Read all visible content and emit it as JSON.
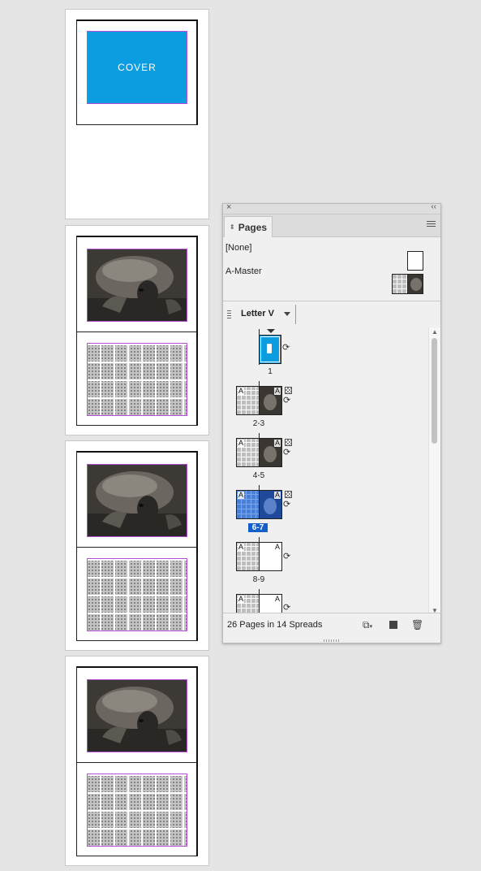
{
  "document": {
    "cover_label": "COVER"
  },
  "panel": {
    "tab_label": "Pages",
    "masters": [
      {
        "name": "[None]"
      },
      {
        "name": "A-Master"
      }
    ],
    "page_size": "Letter V",
    "spreads": [
      {
        "label": "1",
        "master_prefix": "",
        "selected": false
      },
      {
        "label": "2-3",
        "master_prefix": "A",
        "selected": false
      },
      {
        "label": "4-5",
        "master_prefix": "A",
        "selected": false
      },
      {
        "label": "6-7",
        "master_prefix": "A",
        "selected": true
      },
      {
        "label": "8-9",
        "master_prefix": "A",
        "selected": false
      },
      {
        "label": "",
        "master_prefix": "A",
        "selected": false
      }
    ],
    "summary": "26 Pages in 14 Spreads"
  },
  "colors": {
    "accent_blue": "#0b9de0",
    "selection_blue": "#1460c8",
    "frame_purple": "#b24fd6"
  }
}
